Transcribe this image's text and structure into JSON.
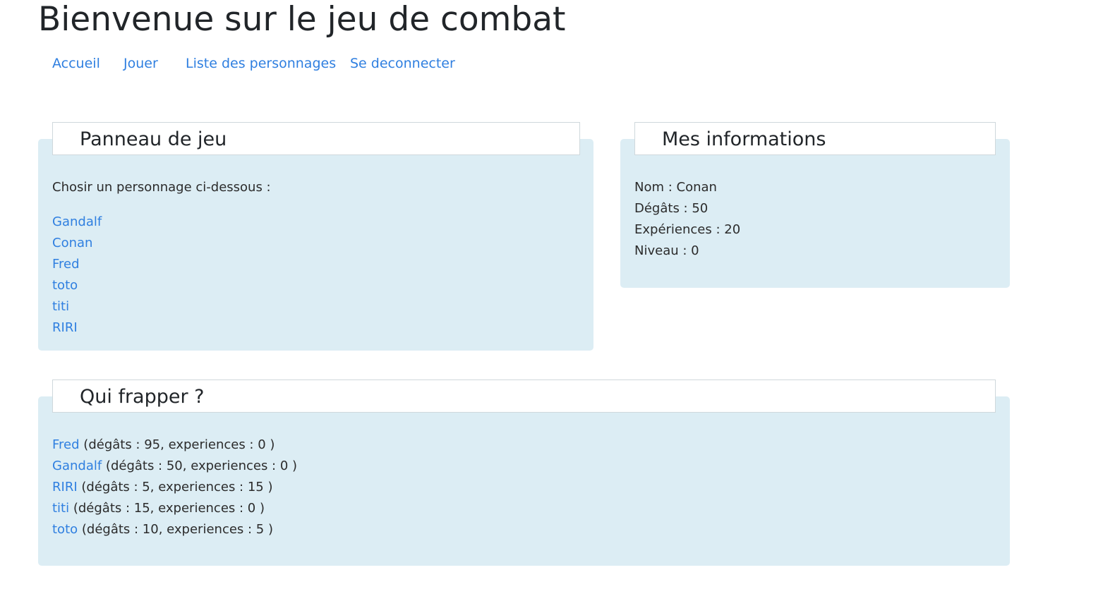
{
  "page": {
    "title": "Bienvenue sur le jeu de combat"
  },
  "nav": {
    "items": [
      {
        "label": "Accueil"
      },
      {
        "label": "Jouer"
      },
      {
        "label": "Liste des personnages"
      },
      {
        "label": "Se deconnecter"
      }
    ]
  },
  "game_panel": {
    "title": "Panneau de jeu",
    "prompt": "Chosir un personnage ci-dessous :",
    "characters": [
      "Gandalf",
      "Conan",
      "Fred",
      "toto",
      "titi",
      "RIRI"
    ]
  },
  "info_panel": {
    "title": "Mes informations",
    "lines": [
      "Nom : Conan",
      "Dégâts : 50",
      "Expériences : 20",
      "Niveau : 0"
    ]
  },
  "hit_panel": {
    "title": "Qui frapper ?",
    "targets": [
      {
        "name": "Fred",
        "details": "(dégâts : 95, experiences : 0 )"
      },
      {
        "name": "Gandalf",
        "details": "(dégâts : 50, experiences : 0 )"
      },
      {
        "name": "RIRI",
        "details": "(dégâts : 5, experiences : 15 )"
      },
      {
        "name": "titi",
        "details": "(dégâts : 15, experiences : 0 )"
      },
      {
        "name": "toto",
        "details": "(dégâts : 10, experiences : 5 )"
      }
    ]
  },
  "colors": {
    "link": "#2f7fe0",
    "panel_background": "#dcedf4",
    "text": "#212529"
  }
}
